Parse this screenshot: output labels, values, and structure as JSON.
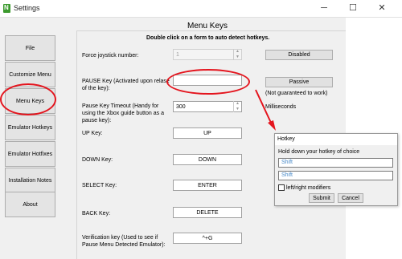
{
  "window": {
    "title": "Settings",
    "minimize": "─",
    "maximize": "☐",
    "close": "✕"
  },
  "sidebar": {
    "items": [
      {
        "label": "File"
      },
      {
        "label": "Customize Menu"
      },
      {
        "label": "Menu Keys"
      },
      {
        "label": "Emulator Hotkeys"
      },
      {
        "label": "Emulator Hotfixes"
      },
      {
        "label": "Installation Notes"
      },
      {
        "label": "About"
      }
    ]
  },
  "main": {
    "title": "Menu Keys",
    "instruction": "Double click on a form to auto detect hotkeys.",
    "joystick": {
      "label": "Force joystick number:",
      "value": "1",
      "button": "Disabled"
    },
    "pause": {
      "label": "PAUSE Key (Activated upon relase of the key):",
      "value": "",
      "button": "Passive",
      "note": "(Not guaranteed to work)"
    },
    "timeout": {
      "label": "Pause Key Timeout (Handy for using the Xbox guide button as a pause key):",
      "value": "300",
      "unit": "Milliseconds"
    },
    "up": {
      "label": "UP Key:",
      "value": "UP"
    },
    "down": {
      "label": "DOWN Key:",
      "value": "DOWN"
    },
    "select": {
      "label": "SELECT Key:",
      "value": "ENTER"
    },
    "back": {
      "label": "BACK Key:",
      "value": "DELETE"
    },
    "verification": {
      "label": "Verification key (Used to see if Pause Menu Detected Emulator):",
      "value": "^+G"
    }
  },
  "hotkey_dialog": {
    "title": "Hotkey",
    "instruction": "Hold down your hotkey of choice",
    "field1": "Shift",
    "field2": "Shift",
    "checkbox_label": "left/right modifiers",
    "submit": "Submit",
    "cancel": "Cancel"
  },
  "colors": {
    "annotation": "#e4151e",
    "accent": "#4a8bc9"
  },
  "icons": {
    "app": "app-icon",
    "arrow": "red-arrow-icon"
  }
}
